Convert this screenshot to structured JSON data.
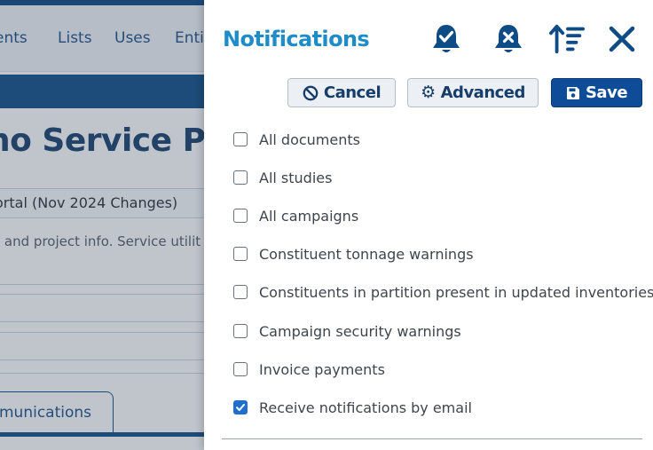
{
  "background": {
    "menu": [
      "ents",
      "Lists",
      "Uses",
      "Enti"
    ],
    "page_title": "no Service Po...",
    "subtitle": "ortal (Nov 2024 Changes)",
    "description": "l and project info. Service utilit",
    "tab_label": "munications"
  },
  "panel": {
    "title": "Notifications",
    "icons": [
      "bell-check-icon",
      "bell-x-icon",
      "sort-ascending-icon",
      "close-icon"
    ],
    "buttons": {
      "cancel": "Cancel",
      "advanced": "Advanced",
      "save": "Save"
    },
    "options": [
      {
        "label": "All documents",
        "checked": false
      },
      {
        "label": "All studies",
        "checked": false
      },
      {
        "label": "All campaigns",
        "checked": false
      },
      {
        "label": "Constituent tonnage warnings",
        "checked": false
      },
      {
        "label": "Constituents in partition present in updated inventories",
        "checked": false
      },
      {
        "label": "Campaign security warnings",
        "checked": false
      },
      {
        "label": "Invoice payments",
        "checked": false
      },
      {
        "label": "Receive notifications by email",
        "checked": true
      }
    ]
  },
  "colors": {
    "title": "#1d8cc8",
    "icon": "#0f4c86",
    "save_button": "#0f4c97",
    "checkbox_checked": "#1f6fd0"
  }
}
